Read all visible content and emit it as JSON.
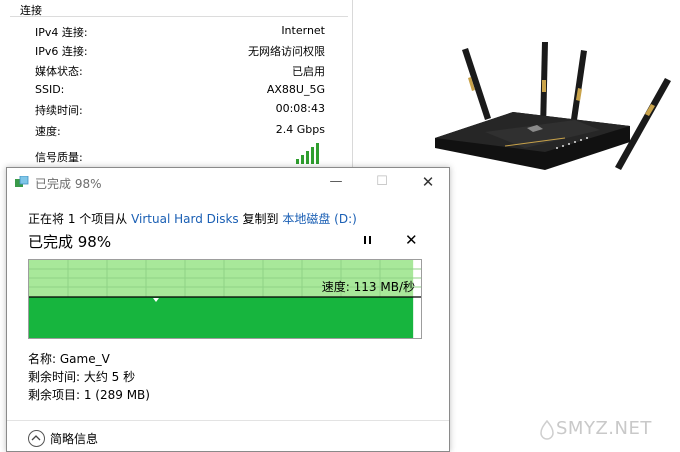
{
  "network": {
    "group_title": "连接",
    "rows": [
      {
        "label": "IPv4 连接:",
        "value": "Internet"
      },
      {
        "label": "IPv6 连接:",
        "value": "无网络访问权限"
      },
      {
        "label": "媒体状态:",
        "value": "已启用"
      },
      {
        "label": "SSID:",
        "value": "AX88U_5G"
      },
      {
        "label": "持续时间:",
        "value": "00:08:43"
      },
      {
        "label": "速度:",
        "value": "2.4 Gbps"
      }
    ],
    "signal_label": "信号质量:",
    "signal_icon": "signal-bars-icon",
    "signal_level": 5
  },
  "copy_dialog": {
    "title": "已完成 98%",
    "copy_prefix": "正在将 1 个项目从",
    "source": "Virtual Hard Disks",
    "copy_middle": "复制到",
    "destination": "本地磁盘 (D:)",
    "progress_text": "已完成 98%",
    "progress_percent": 98,
    "speed_label": "速度: 113 MB/秒",
    "name_line": "名称: Game_V",
    "time_left_line": "剩余时间: 大约 5 秒",
    "items_left_line": "剩余项目: 1 (289 MB)",
    "more_info": "简略信息",
    "icons": {
      "title": "file-copy-icon",
      "pause": "pause-icon",
      "cancel": "close-icon",
      "more": "chevron-up-icon"
    },
    "colors": {
      "progress_fill": "#17b53e",
      "progress_light": "#a8e89a",
      "link": "#1a5fb4"
    }
  },
  "watermark": {
    "text": "SMYZ.NET"
  }
}
